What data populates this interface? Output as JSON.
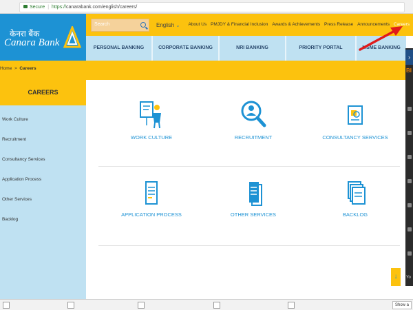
{
  "browser": {
    "secure_label": "Secure",
    "url_scheme": "https://",
    "url_rest": "canarabank.com/english/careers/"
  },
  "brand": {
    "name": "Canara Bank",
    "name_hindi": "केनरा बैंक"
  },
  "header": {
    "search_placeholder": "Search",
    "language": "English",
    "top_links": [
      "About Us",
      "PMJDY & Financial Inclusion",
      "Awards & Achievements",
      "Press Release",
      "Announcements",
      "Careers"
    ]
  },
  "nav": {
    "items": [
      "PERSONAL BANKING",
      "CORPORATE BANKING",
      "NRI BANKING",
      "PRIORITY PORTAL",
      "MSME BANKING"
    ]
  },
  "breadcrumb": {
    "home": "Home",
    "separator": ">",
    "current": "Careers"
  },
  "sidebar": {
    "title": "CAREERS",
    "items": [
      "Work Culture",
      "Recruitment",
      "Consultancy Services",
      "Application Process",
      "Other Services",
      "Backlog"
    ]
  },
  "cards": [
    {
      "label": "WORK CULTURE",
      "icon": "work-culture-icon"
    },
    {
      "label": "RECRUITMENT",
      "icon": "magnifier-person-icon"
    },
    {
      "label": "CONSULTANCY SERVICES",
      "icon": "consultancy-icon"
    },
    {
      "label": "APPLICATION PROCESS",
      "icon": "document-icon"
    },
    {
      "label": "OTHER SERVICES",
      "icon": "documents-icon"
    },
    {
      "label": "BACKLOG",
      "icon": "stack-icon"
    }
  ],
  "side_toolbar": {
    "top_text": "BI",
    "bottom_text": "Yo"
  },
  "downloads": {
    "show_all": "Show a"
  },
  "colors": {
    "brand_yellow": "#fcc20e",
    "brand_blue": "#1d92d4",
    "nav_light_blue": "#bfe1f2",
    "annotation_red": "#e01b1b"
  }
}
